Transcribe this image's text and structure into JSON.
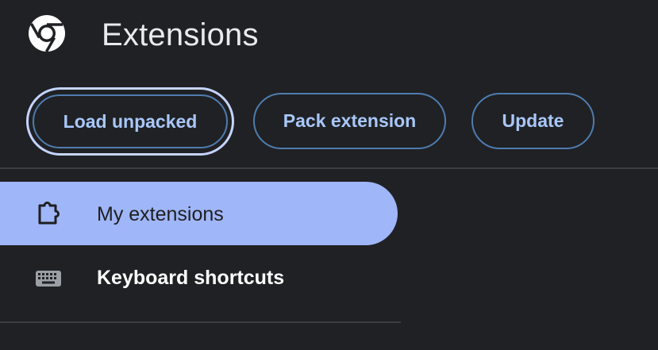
{
  "header": {
    "title": "Extensions",
    "logo_icon": "chrome-logo-icon"
  },
  "toolbar": {
    "load_unpacked_label": "Load unpacked",
    "pack_extension_label": "Pack extension",
    "update_label": "Update"
  },
  "sidebar": {
    "items": [
      {
        "label": "My extensions",
        "icon": "puzzle-icon",
        "active": true
      },
      {
        "label": "Keyboard shortcuts",
        "icon": "keyboard-icon",
        "active": false
      }
    ]
  },
  "colors": {
    "background": "#202124",
    "button_text": "#a8c7fa",
    "button_border": "#4f7cb0",
    "active_nav_bg": "#9fb6f8",
    "focus_ring": "#c5d4ff"
  }
}
